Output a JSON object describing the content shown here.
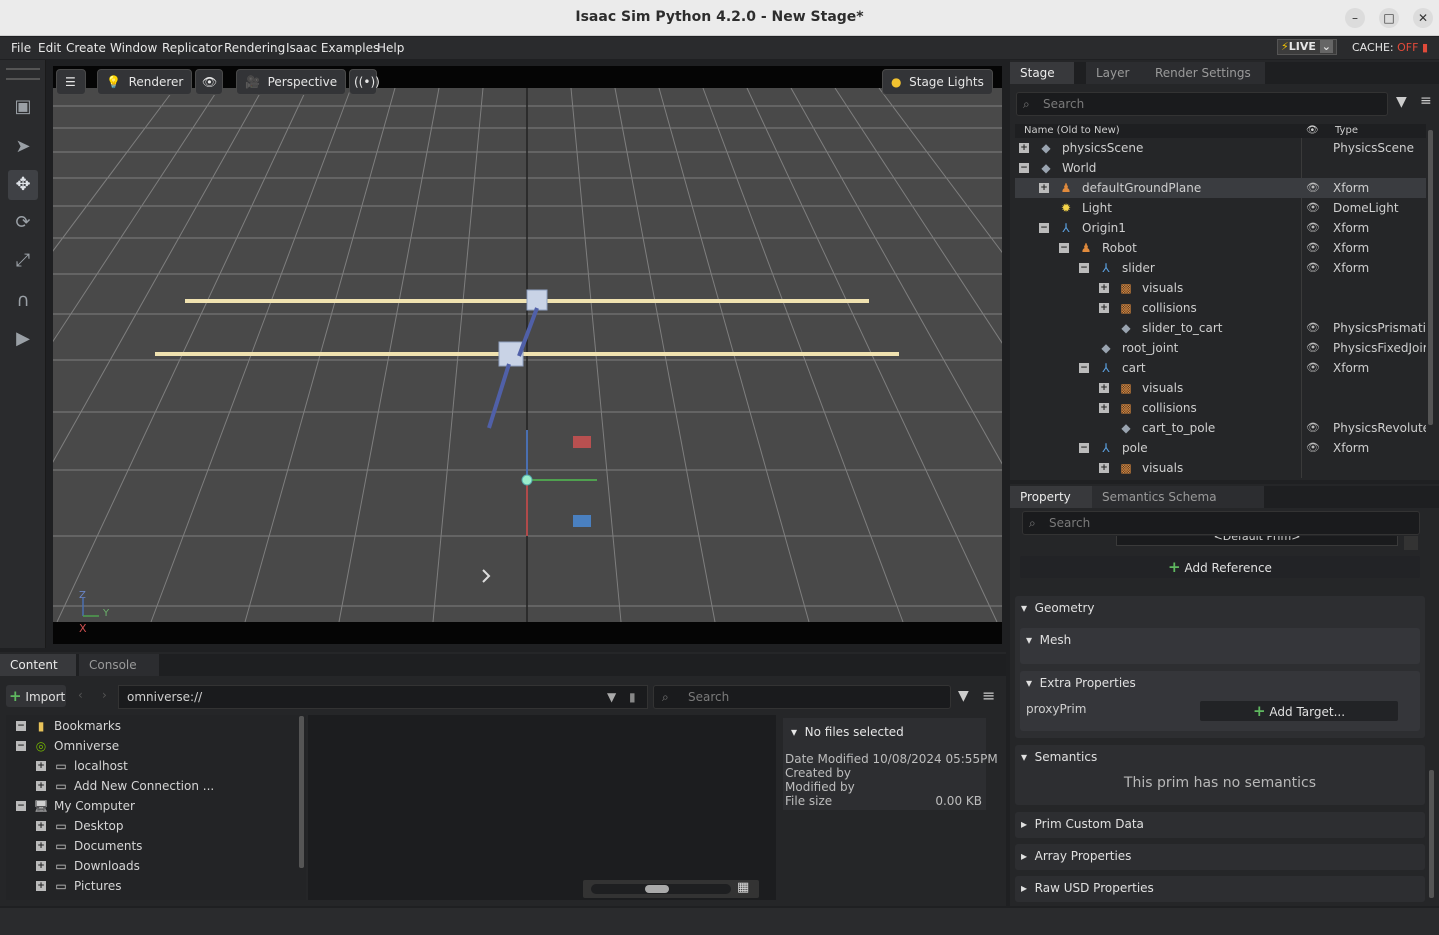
{
  "window": {
    "title": "Isaac Sim Python 4.2.0 - New Stage*"
  },
  "menu": [
    "File",
    "Edit",
    "Create",
    "Window",
    "Replicator",
    "Rendering",
    "Isaac Examples",
    "Help"
  ],
  "live": {
    "label": "LIVE",
    "cache_label": "CACHE:",
    "cache_state": "OFF"
  },
  "viewport": {
    "renderer_label": "Renderer",
    "camera_label": "Perspective",
    "lights_label": "Stage Lights",
    "axes": {
      "z": "Z",
      "y": "Y",
      "x": "X"
    }
  },
  "stage": {
    "tabs": [
      "Stage",
      "Layer",
      "Render Settings"
    ],
    "search_placeholder": "Search",
    "col_name": "Name (Old to New)",
    "col_type": "Type",
    "rows": [
      {
        "name": "physicsScene",
        "type": "PhysicsScene",
        "depth": 0,
        "exp": "+",
        "eye": false,
        "icon": "cube"
      },
      {
        "name": "World",
        "type": "",
        "depth": 0,
        "exp": "-",
        "eye": false,
        "icon": "cube"
      },
      {
        "name": "defaultGroundPlane",
        "type": "Xform",
        "depth": 1,
        "exp": "+",
        "eye": true,
        "icon": "robot",
        "selected": true
      },
      {
        "name": "Light",
        "type": "DomeLight",
        "depth": 1,
        "exp": "",
        "eye": true,
        "icon": "light"
      },
      {
        "name": "Origin1",
        "type": "Xform",
        "depth": 1,
        "exp": "-",
        "eye": true,
        "icon": "xform"
      },
      {
        "name": "Robot",
        "type": "Xform",
        "depth": 2,
        "exp": "-",
        "eye": true,
        "icon": "robot"
      },
      {
        "name": "slider",
        "type": "Xform",
        "depth": 3,
        "exp": "-",
        "eye": true,
        "icon": "xform"
      },
      {
        "name": "visuals",
        "type": "",
        "depth": 4,
        "exp": "+",
        "eye": false,
        "icon": "mesh"
      },
      {
        "name": "collisions",
        "type": "",
        "depth": 4,
        "exp": "+",
        "eye": false,
        "icon": "mesh"
      },
      {
        "name": "slider_to_cart",
        "type": "PhysicsPrismatic",
        "depth": 4,
        "exp": "",
        "eye": true,
        "icon": "cube"
      },
      {
        "name": "root_joint",
        "type": "PhysicsFixedJoir",
        "depth": 3,
        "exp": "",
        "eye": true,
        "icon": "cube"
      },
      {
        "name": "cart",
        "type": "Xform",
        "depth": 3,
        "exp": "-",
        "eye": true,
        "icon": "xform"
      },
      {
        "name": "visuals",
        "type": "",
        "depth": 4,
        "exp": "+",
        "eye": false,
        "icon": "mesh"
      },
      {
        "name": "collisions",
        "type": "",
        "depth": 4,
        "exp": "+",
        "eye": false,
        "icon": "mesh"
      },
      {
        "name": "cart_to_pole",
        "type": "PhysicsRevolute",
        "depth": 4,
        "exp": "",
        "eye": true,
        "icon": "cube"
      },
      {
        "name": "pole",
        "type": "Xform",
        "depth": 3,
        "exp": "-",
        "eye": true,
        "icon": "xform"
      },
      {
        "name": "visuals",
        "type": "",
        "depth": 4,
        "exp": "+",
        "eye": false,
        "icon": "mesh"
      }
    ]
  },
  "property": {
    "tabs": [
      "Property",
      "Semantics Schema Editor"
    ],
    "search_placeholder": "Search",
    "default_prim": "<Default Prim>",
    "add_reference": "Add Reference",
    "geometry": "Geometry",
    "mesh": "Mesh",
    "extra_properties": "Extra Properties",
    "proxy_prim": "proxyPrim",
    "add_target": "Add Target...",
    "semantics": "Semantics",
    "no_semantics": "This prim has no semantics",
    "prim_custom_data": "Prim Custom Data",
    "array_properties": "Array Properties",
    "raw_usd": "Raw USD Properties"
  },
  "content": {
    "tabs": [
      "Content",
      "Console"
    ],
    "import_label": "Import",
    "path": "omniverse://",
    "search_placeholder": "Search",
    "tree": [
      {
        "name": "Bookmarks",
        "depth": 0,
        "exp": "-",
        "icon": "bookmark"
      },
      {
        "name": "Omniverse",
        "depth": 0,
        "exp": "-",
        "icon": "omniverse"
      },
      {
        "name": "localhost",
        "depth": 1,
        "exp": "+",
        "icon": "drive"
      },
      {
        "name": "Add New Connection ...",
        "depth": 1,
        "exp": "+",
        "icon": "drive"
      },
      {
        "name": "My Computer",
        "depth": 0,
        "exp": "-",
        "icon": "computer"
      },
      {
        "name": "Desktop",
        "depth": 1,
        "exp": "+",
        "icon": "drive"
      },
      {
        "name": "Documents",
        "depth": 1,
        "exp": "+",
        "icon": "drive"
      },
      {
        "name": "Downloads",
        "depth": 1,
        "exp": "+",
        "icon": "drive"
      },
      {
        "name": "Pictures",
        "depth": 1,
        "exp": "+",
        "icon": "drive"
      }
    ],
    "details": {
      "header": "No files selected",
      "date_modified": "Date Modified 10/08/2024 05:55PM",
      "created_by": "Created by",
      "modified_by": "Modified by",
      "file_size_label": "File size",
      "file_size": "0.00 KB"
    }
  },
  "colors": {
    "accent": "#76b900",
    "selection": "#3a3c40",
    "ground_line": "#f0e2b0"
  }
}
